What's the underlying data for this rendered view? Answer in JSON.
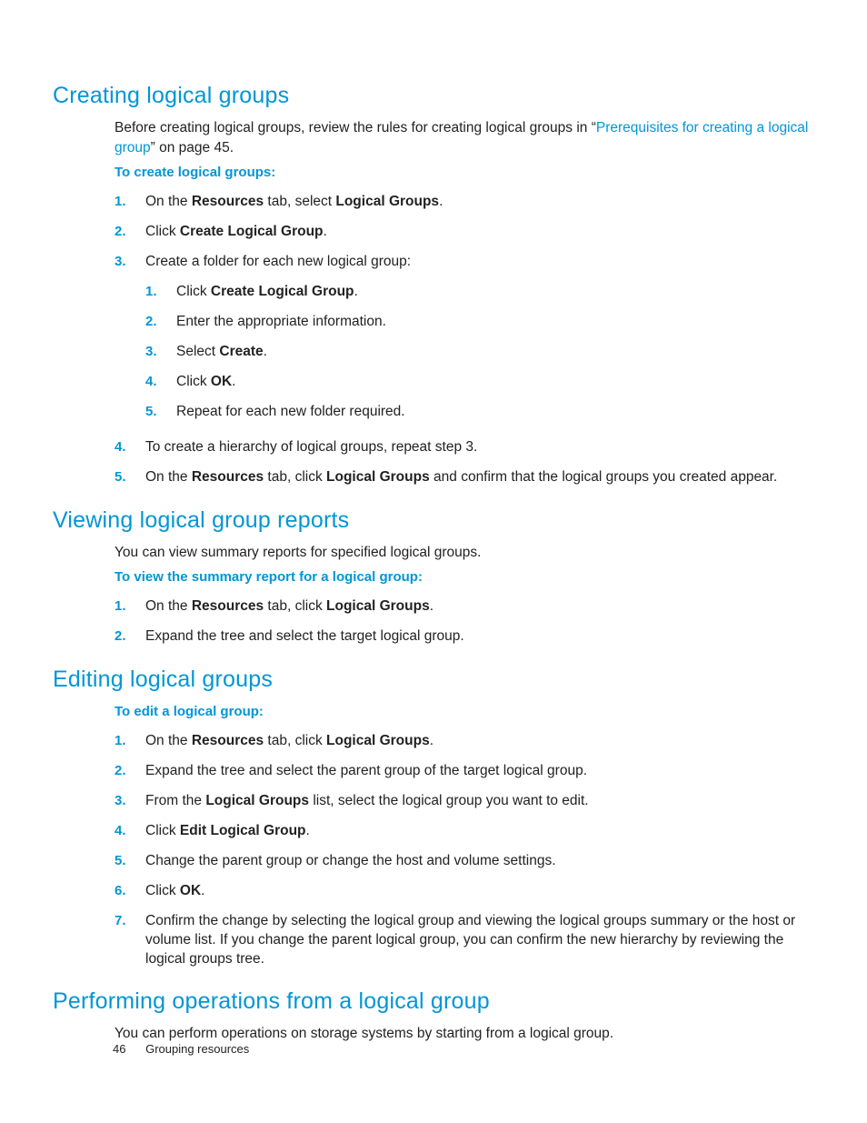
{
  "sections": {
    "s1": {
      "title": "Creating logical groups",
      "intro_pre": "Before creating logical groups, review the rules for creating logical groups in “",
      "intro_link": "Prerequisites for creating a logical group",
      "intro_post": "” on page 45.",
      "instr": "To create logical groups:",
      "steps": {
        "n1": "1.",
        "t1a": "On the ",
        "t1b": "Resources",
        "t1c": " tab, select ",
        "t1d": "Logical Groups",
        "t1e": ".",
        "n2": "2.",
        "t2a": "Click ",
        "t2b": "Create Logical Group",
        "t2c": ".",
        "n3": "3.",
        "t3": "Create a folder for each new logical group:",
        "sub": {
          "sn1": "1.",
          "st1a": "Click ",
          "st1b": "Create Logical Group",
          "st1c": ".",
          "sn2": "2.",
          "st2": "Enter the appropriate information.",
          "sn3": "3.",
          "st3a": "Select ",
          "st3b": "Create",
          "st3c": ".",
          "sn4": "4.",
          "st4a": "Click ",
          "st4b": "OK",
          "st4c": ".",
          "sn5": "5.",
          "st5": "Repeat for each new folder required."
        },
        "n4": "4.",
        "t4": "To create a hierarchy of logical groups, repeat step 3.",
        "n5": "5.",
        "t5a": "On the ",
        "t5b": "Resources",
        "t5c": " tab, click ",
        "t5d": "Logical Groups",
        "t5e": " and confirm that the logical groups you created appear."
      }
    },
    "s2": {
      "title": "Viewing logical group reports",
      "intro": "You can view summary reports for specified logical groups.",
      "instr": "To view the summary report for a logical group:",
      "steps": {
        "n1": "1.",
        "t1a": "On the ",
        "t1b": "Resources",
        "t1c": " tab, click ",
        "t1d": "Logical Groups",
        "t1e": ".",
        "n2": "2.",
        "t2": "Expand the tree and select the target logical group."
      }
    },
    "s3": {
      "title": "Editing logical groups",
      "instr": "To edit a logical group:",
      "steps": {
        "n1": "1.",
        "t1a": "On the ",
        "t1b": "Resources",
        "t1c": " tab, click ",
        "t1d": "Logical Groups",
        "t1e": ".",
        "n2": "2.",
        "t2": "Expand the tree and select the parent group of the target logical group.",
        "n3": "3.",
        "t3a": "From the  ",
        "t3b": "Logical Groups",
        "t3c": " list, select the logical group you want to edit.",
        "n4": "4.",
        "t4a": "Click ",
        "t4b": "Edit Logical Group",
        "t4c": ".",
        "n5": "5.",
        "t5": "Change the parent group or change the host and volume settings.",
        "n6": "6.",
        "t6a": "Click ",
        "t6b": "OK",
        "t6c": ".",
        "n7": "7.",
        "t7": "Confirm the change by selecting the logical group and viewing the logical groups summary or the host or volume list. If you change the parent logical group, you can confirm the new hierarchy by reviewing the logical groups tree."
      }
    },
    "s4": {
      "title": "Performing operations from a logical group",
      "intro": "You can perform operations on storage systems by starting from a logical group."
    }
  },
  "footer": {
    "page": "46",
    "chapter": "Grouping resources"
  }
}
